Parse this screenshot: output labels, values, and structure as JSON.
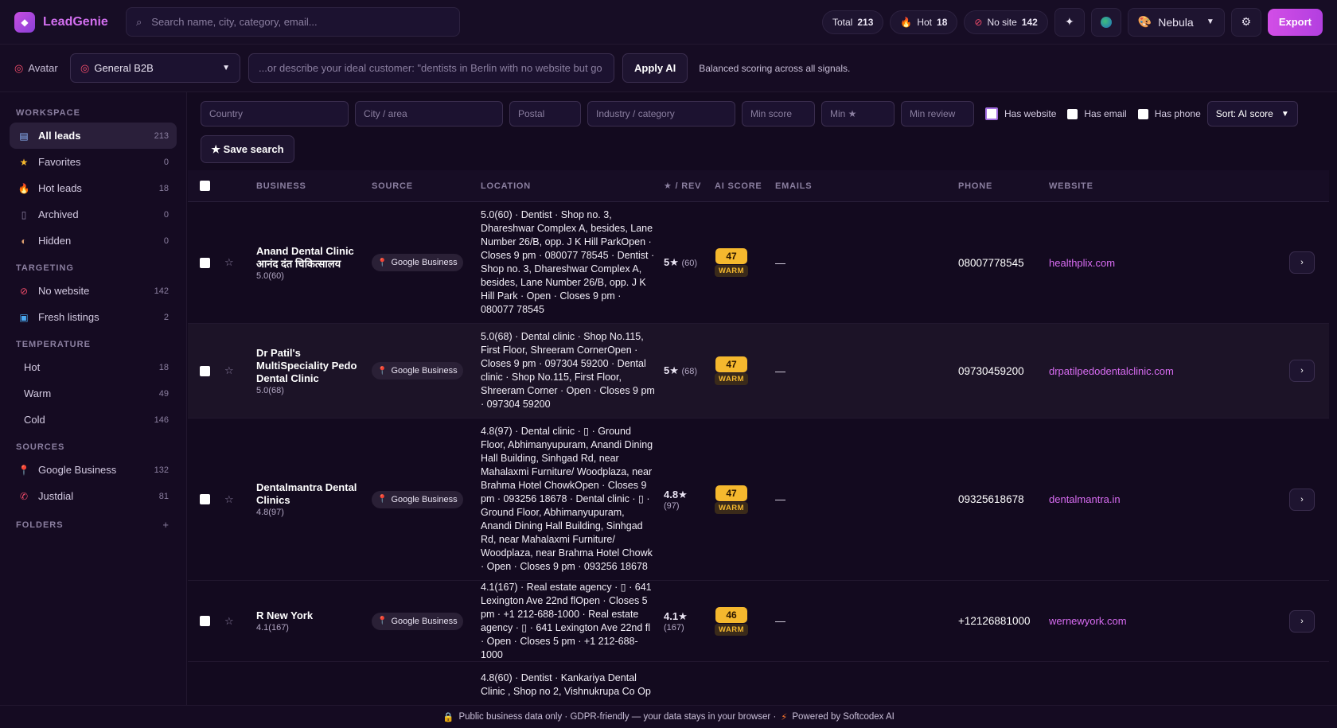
{
  "app": {
    "name": "LeadGenie"
  },
  "search": {
    "placeholder": "Search name, city, category, email..."
  },
  "pills": {
    "total_label": "Total",
    "total_value": "213",
    "hot_label": "Hot",
    "hot_value": "18",
    "nosite_label": "No site",
    "nosite_value": "142"
  },
  "theme": {
    "value": "Nebula"
  },
  "export_label": "Export",
  "avatar": {
    "label": "Avatar",
    "selected": "General B2B",
    "describe_placeholder": "...or describe your ideal customer: \"dentists in Berlin with no website but go",
    "apply_label": "Apply AI",
    "note": "Balanced scoring across all signals."
  },
  "sidebar": {
    "workspace_head": "WORKSPACE",
    "workspace": [
      {
        "label": "All leads",
        "count": "213"
      },
      {
        "label": "Favorites",
        "count": "0"
      },
      {
        "label": "Hot leads",
        "count": "18"
      },
      {
        "label": "Archived",
        "count": "0"
      },
      {
        "label": "Hidden",
        "count": "0"
      }
    ],
    "targeting_head": "TARGETING",
    "targeting": [
      {
        "label": "No website",
        "count": "142"
      },
      {
        "label": "Fresh listings",
        "count": "2"
      }
    ],
    "temperature_head": "TEMPERATURE",
    "temperature": [
      {
        "label": "Hot",
        "count": "18"
      },
      {
        "label": "Warm",
        "count": "49"
      },
      {
        "label": "Cold",
        "count": "146"
      }
    ],
    "sources_head": "SOURCES",
    "sources": [
      {
        "label": "Google Business",
        "count": "132"
      },
      {
        "label": "Justdial",
        "count": "81"
      }
    ],
    "folders_head": "FOLDERS",
    "folders_add": "+"
  },
  "filters": {
    "country": "Country",
    "city": "City / area",
    "postal": "Postal",
    "industry": "Industry / category",
    "min_score": "Min score",
    "min_star": "Min ★",
    "min_review": "Min review",
    "has_website": "Has website",
    "has_email": "Has email",
    "has_phone": "Has phone",
    "sort": "Sort: AI score",
    "save_search": "★ Save search"
  },
  "table": {
    "headers": {
      "business": "BUSINESS",
      "source": "SOURCE",
      "location": "LOCATION",
      "rev": "★ / REV",
      "ai": "AI SCORE",
      "emails": "EMAILS",
      "phone": "PHONE",
      "website": "WEBSITE"
    },
    "rows": [
      {
        "name": "Anand Dental Clinic आनंद दंत चिकित्सालय",
        "sub": "5.0(60)",
        "source": "Google Business",
        "location": "5.0(60) · Dentist · Shop no. 3, Dhareshwar Complex A, besides, Lane Number 26/B, opp. J K Hill ParkOpen · Closes 9 pm · 080077 78545 · Dentist · Shop no. 3, Dhareshwar Complex A, besides, Lane Number 26/B, opp. J K Hill Park · Open · Closes 9 pm · 080077 78545",
        "rating": "5★",
        "reviews": "(60)",
        "score": "47",
        "tag": "WARM",
        "emails": "—",
        "phone": "08007778545",
        "website": "healthplix.com"
      },
      {
        "name": "Dr Patil's MultiSpeciality Pedo Dental Clinic",
        "sub": "5.0(68)",
        "source": "Google Business",
        "location": "5.0(68) · Dental clinic · Shop No.115, First Floor, Shreeram CornerOpen · Closes 9 pm · 097304 59200 · Dental clinic · Shop No.115, First Floor, Shreeram Corner · Open · Closes 9 pm · 097304 59200",
        "rating": "5★",
        "reviews": "(68)",
        "score": "47",
        "tag": "WARM",
        "emails": "—",
        "phone": "09730459200",
        "website": "drpatilpedodentalclinic.com"
      },
      {
        "name": "Dentalmantra Dental Clinics",
        "sub": "4.8(97)",
        "source": "Google Business",
        "location": "4.8(97) · Dental clinic · ▯ · Ground Floor, Abhimanyupuram, Anandi Dining Hall Building, Sinhgad Rd, near Mahalaxmi Furniture/ Woodplaza, near Brahma Hotel ChowkOpen · Closes 9 pm · 093256 18678 · Dental clinic · ▯ · Ground Floor, Abhimanyupuram, Anandi Dining Hall Building, Sinhgad Rd, near Mahalaxmi Furniture/ Woodplaza, near Brahma Hotel Chowk · Open · Closes 9 pm · 093256 18678",
        "rating": "4.8★",
        "reviews": "(97)",
        "score": "47",
        "tag": "WARM",
        "emails": "—",
        "phone": "09325618678",
        "website": "dentalmantra.in"
      },
      {
        "name": "R New York",
        "sub": "4.1(167)",
        "source": "Google Business",
        "location": "4.1(167) · Real estate agency · ▯ · 641 Lexington Ave 22nd flOpen · Closes 5 pm · +1 212-688-1000 · Real estate agency · ▯ · 641 Lexington Ave 22nd fl · Open · Closes 5 pm · +1 212-688-1000",
        "rating": "4.1★",
        "reviews": "(167)",
        "score": "46",
        "tag": "WARM",
        "emails": "—",
        "phone": "+12126881000",
        "website": "wernewyork.com"
      },
      {
        "location": "4.8(60) · Dentist · Kankariya Dental Clinic , Shop no 2, Vishnukrupa Co Op"
      }
    ]
  },
  "footer": {
    "left": "Public business data only · GDPR-friendly — your data stays in your browser ·",
    "right": "Powered by Softcodex AI"
  }
}
